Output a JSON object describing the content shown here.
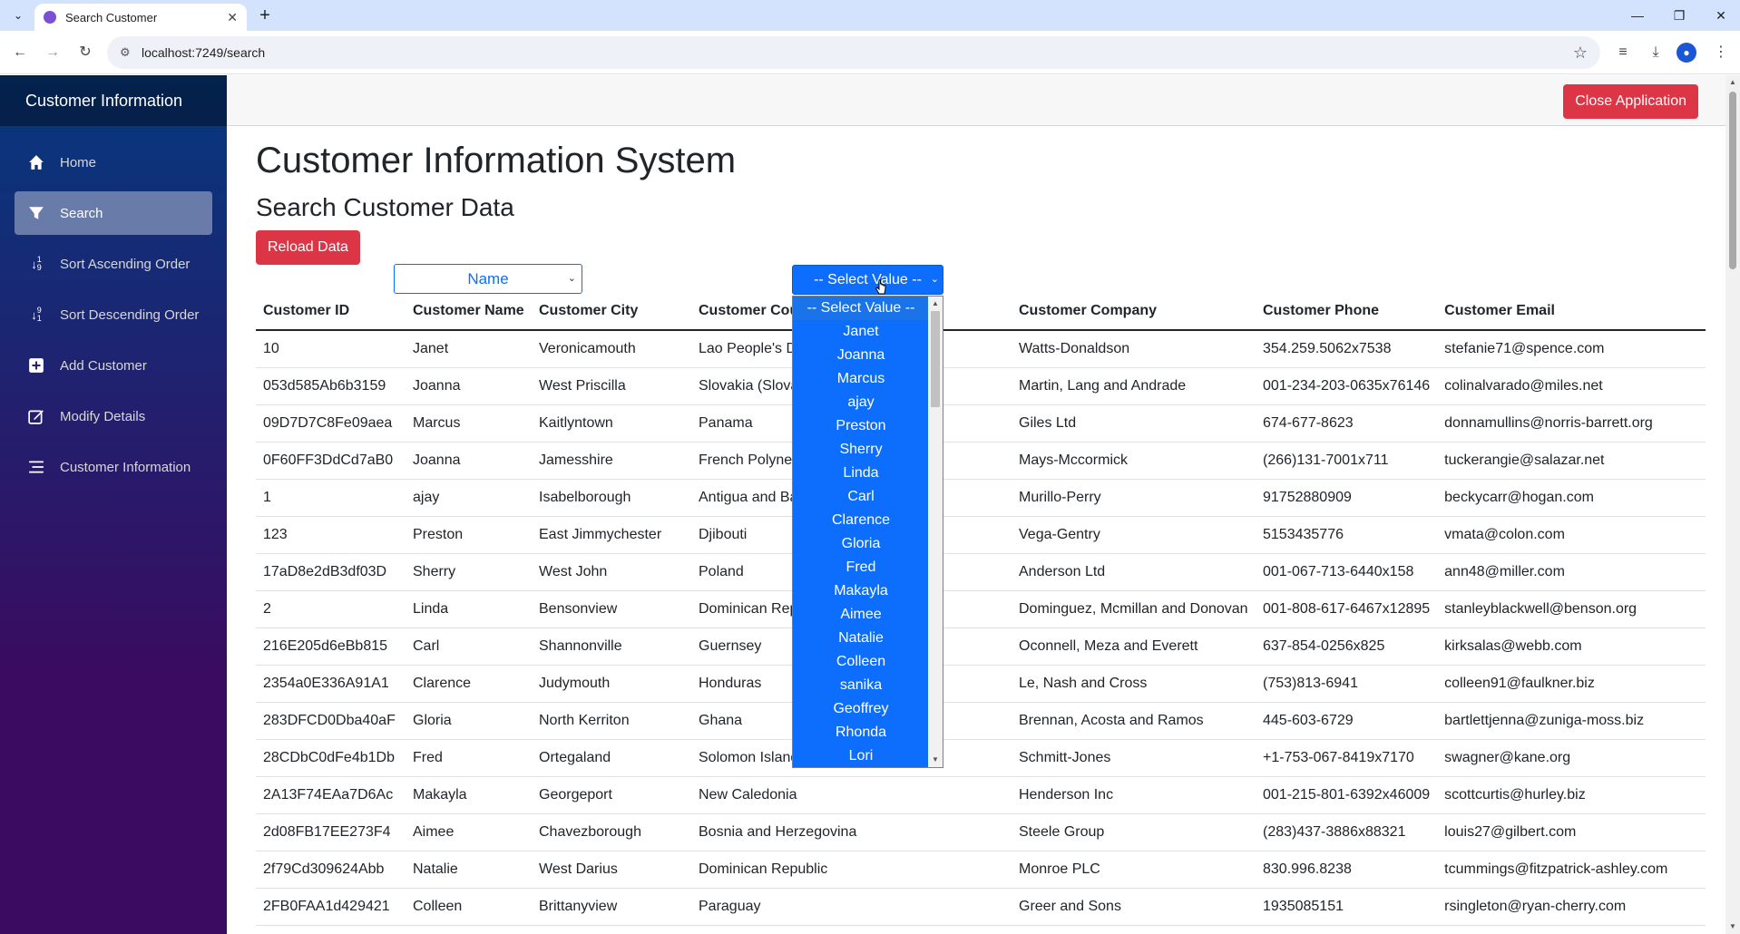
{
  "browser": {
    "tab_title": "Search Customer",
    "url": "localhost:7249/search"
  },
  "sidebar": {
    "brand": "Customer Information",
    "items": [
      {
        "label": "Home",
        "icon": "home-icon"
      },
      {
        "label": "Search",
        "icon": "filter-icon"
      },
      {
        "label": "Sort Ascending Order",
        "icon": "sort-ascending-icon"
      },
      {
        "label": "Sort Descending Order",
        "icon": "sort-descending-icon"
      },
      {
        "label": "Add Customer",
        "icon": "plus-square-icon"
      },
      {
        "label": "Modify Details",
        "icon": "edit-icon"
      },
      {
        "label": "Customer Information",
        "icon": "list-icon"
      }
    ]
  },
  "topbar": {
    "close_label": "Close Application"
  },
  "main": {
    "title": "Customer Information System",
    "subtitle": "Search Customer Data",
    "reload_label": "Reload Data",
    "field_select": "Name",
    "value_select": "-- Select Value --"
  },
  "table": {
    "headers": [
      "Customer ID",
      "Customer Name",
      "Customer City",
      "Customer Country",
      "Customer Company",
      "Customer Phone",
      "Customer Email"
    ],
    "rows": [
      [
        "10",
        "Janet",
        "Veronicamouth",
        "Lao People's D",
        "Watts-Donaldson",
        "354.259.5062x7538",
        "stefanie71@spence.com"
      ],
      [
        "053d585Ab6b3159",
        "Joanna",
        "West Priscilla",
        "Slovakia (Slova",
        "Martin, Lang and Andrade",
        "001-234-203-0635x76146",
        "colinalvarado@miles.net"
      ],
      [
        "09D7D7C8Fe09aea",
        "Marcus",
        "Kaitlyntown",
        "Panama",
        "Giles Ltd",
        "674-677-8623",
        "donnamullins@norris-barrett.org"
      ],
      [
        "0F60FF3DdCd7aB0",
        "Joanna",
        "Jamesshire",
        "French Polyne",
        "Mays-Mccormick",
        "(266)131-7001x711",
        "tuckerangie@salazar.net"
      ],
      [
        "1",
        "ajay",
        "Isabelborough",
        "Antigua and Ba",
        "Murillo-Perry",
        "91752880909",
        "beckycarr@hogan.com"
      ],
      [
        "123",
        "Preston",
        "East Jimmychester",
        "Djibouti",
        "Vega-Gentry",
        "5153435776",
        "vmata@colon.com"
      ],
      [
        "17aD8e2dB3df03D",
        "Sherry",
        "West John",
        "Poland",
        "Anderson Ltd",
        "001-067-713-6440x158",
        "ann48@miller.com"
      ],
      [
        "2",
        "Linda",
        "Bensonview",
        "Dominican Rep",
        "Dominguez, Mcmillan and Donovan",
        "001-808-617-6467x12895",
        "stanleyblackwell@benson.org"
      ],
      [
        "216E205d6eBb815",
        "Carl",
        "Shannonville",
        "Guernsey",
        "Oconnell, Meza and Everett",
        "637-854-0256x825",
        "kirksalas@webb.com"
      ],
      [
        "2354a0E336A91A1",
        "Clarence",
        "Judymouth",
        "Honduras",
        "Le, Nash and Cross",
        "(753)813-6941",
        "colleen91@faulkner.biz"
      ],
      [
        "283DFCD0Dba40aF",
        "Gloria",
        "North Kerriton",
        "Ghana",
        "Brennan, Acosta and Ramos",
        "445-603-6729",
        "bartlettjenna@zuniga-moss.biz"
      ],
      [
        "28CDbC0dFe4b1Db",
        "Fred",
        "Ortegaland",
        "Solomon Island",
        "Schmitt-Jones",
        "+1-753-067-8419x7170",
        "swagner@kane.org"
      ],
      [
        "2A13F74EAa7D6Ac",
        "Makayla",
        "Georgeport",
        "New Caledonia",
        "Henderson Inc",
        "001-215-801-6392x46009",
        "scottcurtis@hurley.biz"
      ],
      [
        "2d08FB17EE273F4",
        "Aimee",
        "Chavezborough",
        "Bosnia and Herzegovina",
        "Steele Group",
        "(283)437-3886x88321",
        "louis27@gilbert.com"
      ],
      [
        "2f79Cd309624Abb",
        "Natalie",
        "West Darius",
        "Dominican Republic",
        "Monroe PLC",
        "830.996.8238",
        "tcummings@fitzpatrick-ashley.com"
      ],
      [
        "2FB0FAA1d429421",
        "Colleen",
        "Brittanyview",
        "Paraguay",
        "Greer and Sons",
        "1935085151",
        "rsingleton@ryan-cherry.com"
      ]
    ]
  },
  "dropdown": {
    "options": [
      "-- Select Value --",
      "Janet",
      "Joanna",
      "Marcus",
      "ajay",
      "Preston",
      "Sherry",
      "Linda",
      "Carl",
      "Clarence",
      "Gloria",
      "Fred",
      "Makayla",
      "Aimee",
      "Natalie",
      "Colleen",
      "sanika",
      "Geoffrey",
      "Rhonda",
      "Lori"
    ]
  },
  "colors": {
    "primary": "#0d6efd",
    "danger": "#dc3545",
    "sidebar_top": "#05397f",
    "sidebar_bottom": "#3a0b60"
  }
}
